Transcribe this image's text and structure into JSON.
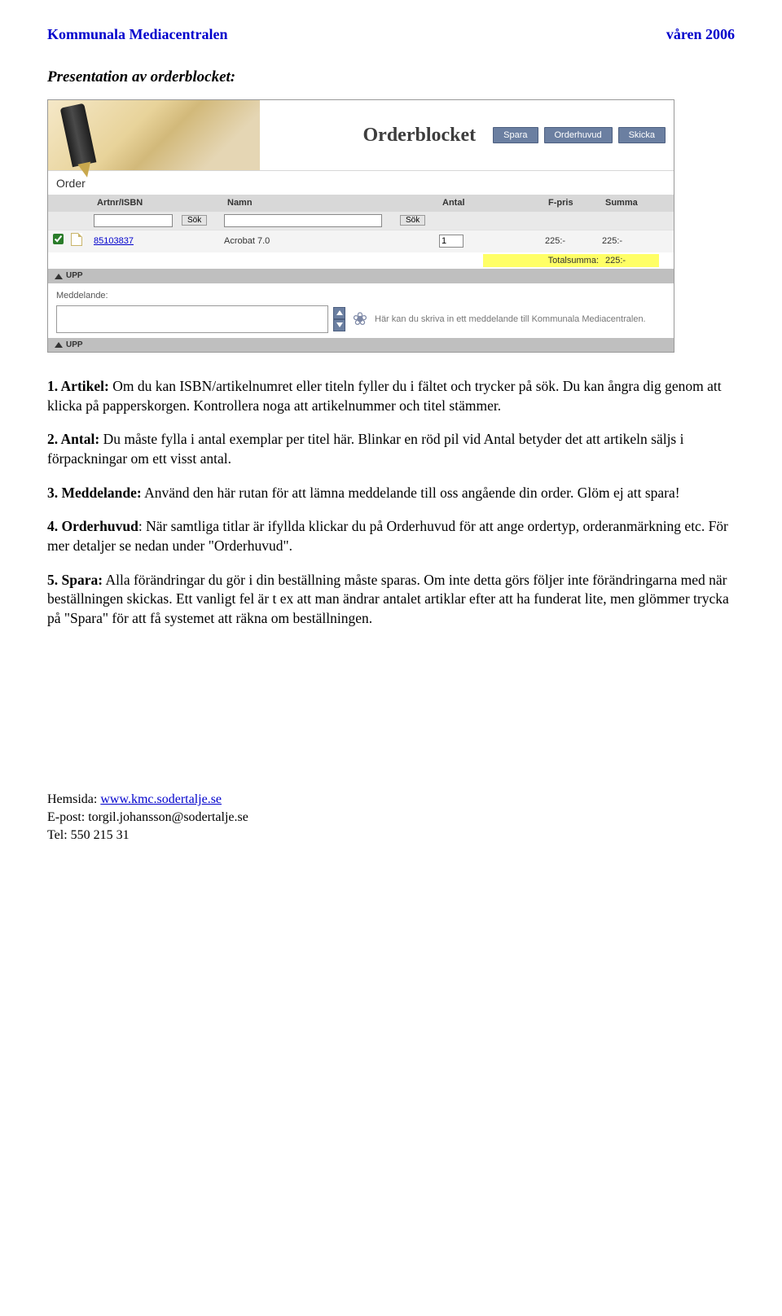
{
  "header": {
    "left": "Kommunala Mediacentralen",
    "right": "våren 2006"
  },
  "section_title": "Presentation av orderblocket:",
  "screenshot": {
    "banner_title": "Orderblocket",
    "buttons": {
      "spara": "Spara",
      "orderhuvud": "Orderhuvud",
      "skicka": "Skicka"
    },
    "order_heading": "Order",
    "columns": {
      "artnr": "Artnr/ISBN",
      "namn": "Namn",
      "antal": "Antal",
      "fpris": "F-pris",
      "summa": "Summa"
    },
    "sok": "Sök",
    "row": {
      "art": "85103837",
      "namn": "Acrobat 7.0",
      "antal": "1",
      "fpris": "225:-",
      "summa": "225:-"
    },
    "total_label": "Totalsumma:",
    "total_value": "225:-",
    "upp": "UPP",
    "medd_label": "Meddelande:",
    "hint": "Här kan du skriva in ett meddelande till Kommunala Mediacentralen."
  },
  "paras": {
    "p1a": "1. Artikel:",
    "p1b": " Om du kan ISBN/artikelnumret eller titeln fyller du i fältet och trycker på sök. Du kan ångra dig genom att klicka på papperskorgen. Kontrollera noga att artikelnummer och titel stämmer.",
    "p2a": "2. Antal:",
    "p2b": " Du måste fylla i antal exemplar per titel här. Blinkar en röd pil vid Antal betyder det att artikeln säljs i förpackningar om ett visst antal.",
    "p3a": "3. Meddelande:",
    "p3b": " Använd den här rutan för att lämna meddelande till oss angående din order. Glöm ej att spara!",
    "p4a": "4. Orderhuvud",
    "p4b": ": När samtliga titlar är ifyllda klickar du på Orderhuvud för att ange ordertyp, orderanmärkning etc. För mer detaljer se nedan under \"Orderhuvud\".",
    "p5a": "5. Spara:",
    "p5b": " Alla förändringar du gör i din beställning måste sparas. Om inte detta görs följer inte förändringarna med när beställningen skickas. Ett vanligt fel är t ex att man ändrar antalet artiklar efter att ha funderat lite, men glömmer trycka på \"Spara\" för att få systemet att räkna om beställningen."
  },
  "footer": {
    "l1a": "Hemsida: ",
    "l1b": "www.kmc.sodertalje.se",
    "l2": "E-post: torgil.johansson@sodertalje.se",
    "l3": "Tel: 550 215 31"
  }
}
